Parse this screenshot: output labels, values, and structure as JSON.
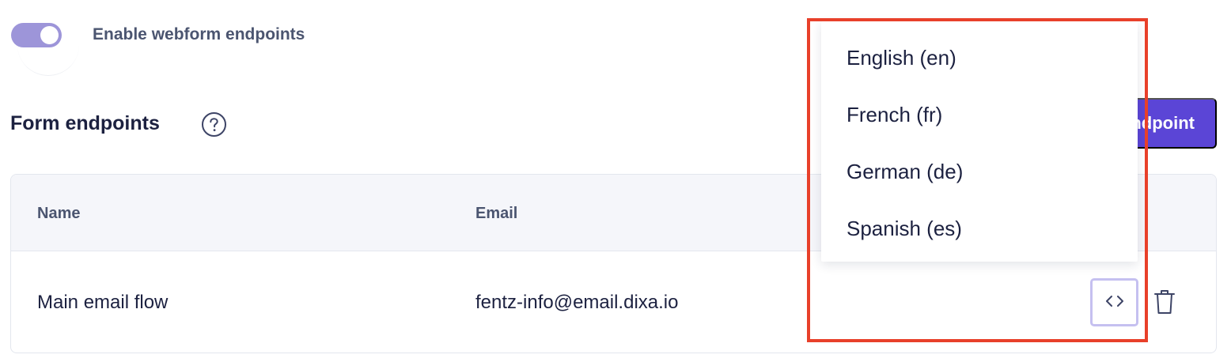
{
  "settings": {
    "toggle_label": "Enable webform endpoints",
    "toggle_on": true
  },
  "section": {
    "title": "Form endpoints",
    "add_button_label": "Add endpoint"
  },
  "table": {
    "columns": [
      "Name",
      "Email"
    ],
    "rows": [
      {
        "name": "Main email flow",
        "email": "fentz-info@email.dixa.io"
      }
    ]
  },
  "language_menu": {
    "items": [
      "English (en)",
      "French (fr)",
      "German (de)",
      "Spanish (es)"
    ]
  },
  "icons": {
    "help": "question-circle-icon",
    "embed": "code-brackets-icon",
    "delete": "trash-icon"
  },
  "colors": {
    "accent": "#5b45d6",
    "toggle": "#9d95d9",
    "highlight": "#e8402a",
    "text": "#1c2140",
    "muted": "#4b5570"
  }
}
